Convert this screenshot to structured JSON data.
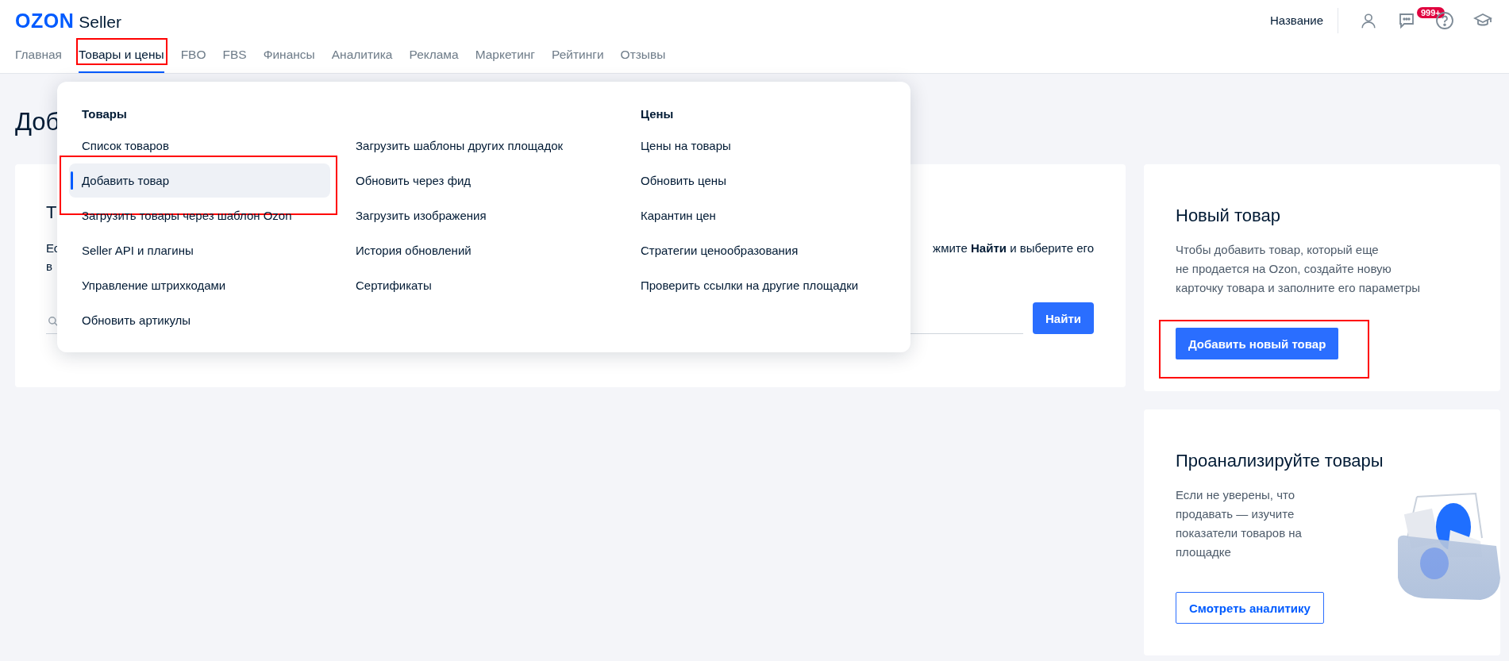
{
  "logo": {
    "brand": "OZON",
    "product": "Seller"
  },
  "header": {
    "company": "Название",
    "notifications_badge": "999+"
  },
  "nav": [
    {
      "label": "Главная",
      "selected": false,
      "highlighted": false
    },
    {
      "label": "Товары и цены",
      "selected": true,
      "highlighted": true
    },
    {
      "label": "FBO",
      "selected": false,
      "highlighted": false
    },
    {
      "label": "FBS",
      "selected": false,
      "highlighted": false
    },
    {
      "label": "Финансы",
      "selected": false,
      "highlighted": false
    },
    {
      "label": "Аналитика",
      "selected": false,
      "highlighted": false
    },
    {
      "label": "Реклама",
      "selected": false,
      "highlighted": false
    },
    {
      "label": "Маркетинг",
      "selected": false,
      "highlighted": false
    },
    {
      "label": "Рейтинги",
      "selected": false,
      "highlighted": false
    },
    {
      "label": "Отзывы",
      "selected": false,
      "highlighted": false
    }
  ],
  "page_title": "Доб",
  "search_card": {
    "title": "Т",
    "text_start": "Ес",
    "text_end": "жмите **Найти** и выберите его",
    "text_line2": "в",
    "button": "Найти"
  },
  "menu": {
    "columns": [
      {
        "heading": "Товары",
        "items": [
          {
            "label": "Список товаров",
            "selected": false,
            "highlighted": false
          },
          {
            "label": "Добавить товар",
            "selected": true,
            "highlighted": true
          },
          {
            "label": "Загрузить товары через шаблон Ozon",
            "selected": false,
            "highlighted": false
          },
          {
            "label": "Seller API и плагины",
            "selected": false,
            "highlighted": false
          },
          {
            "label": "Управление штрихкодами",
            "selected": false,
            "highlighted": false
          },
          {
            "label": "Обновить артикулы",
            "selected": false,
            "highlighted": false
          }
        ]
      },
      {
        "items": [
          {
            "label": "Загрузить шаблоны других площадок",
            "selected": false,
            "highlighted": false
          },
          {
            "label": "Обновить через фид",
            "selected": false,
            "highlighted": false
          },
          {
            "label": "Загрузить изображения",
            "selected": false,
            "highlighted": false
          },
          {
            "label": "История обновлений",
            "selected": false,
            "highlighted": false
          },
          {
            "label": "Сертификаты",
            "selected": false,
            "highlighted": false
          }
        ]
      },
      {
        "heading": "Цены",
        "items": [
          {
            "label": "Цены на товары",
            "selected": false,
            "highlighted": false
          },
          {
            "label": "Обновить цены",
            "selected": false,
            "highlighted": false
          },
          {
            "label": "Карантин цен",
            "selected": false,
            "highlighted": false
          },
          {
            "label": "Стратегии ценообразования",
            "selected": false,
            "highlighted": false
          },
          {
            "label": "Проверить ссылки на другие площадки",
            "selected": false,
            "highlighted": false
          }
        ]
      }
    ]
  },
  "side_cards": [
    {
      "kind": "primary",
      "title": "Новый товар",
      "text": "Чтобы добавить товар, который еще\nне продается на Ozon, создайте новую\nкарточку товара и заполните его параметры",
      "button": "Добавить новый товар",
      "highlighted": true
    },
    {
      "kind": "outline",
      "title": "Проанализируйте товары",
      "text": "Если не уверены, что\nпродавать — изучите\nпоказатели товаров на\nплощадке",
      "button": "Смотреть аналитику",
      "highlighted": false
    }
  ]
}
